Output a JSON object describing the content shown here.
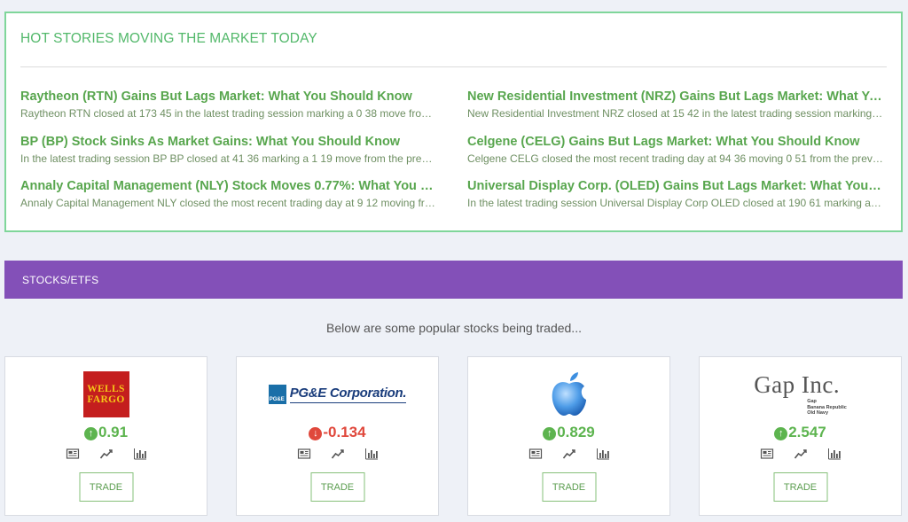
{
  "hot_stories": {
    "title": "HOT STORIES MOVING THE MARKET TODAY",
    "items": [
      {
        "title": "Raytheon (RTN) Gains But Lags Market: What You Should Know",
        "desc": "Raytheon RTN closed at 173 45 in the latest trading session marking a 0 38 move from the prior day"
      },
      {
        "title": "New Residential Investment (NRZ) Gains But Lags Market: What You Should Know",
        "desc": "New Residential Investment NRZ closed at 15 42 in the latest trading session marking a move from the prior day"
      },
      {
        "title": "BP (BP) Stock Sinks As Market Gains: What You Should Know",
        "desc": "In the latest trading session BP BP closed at 41 36 marking a 1 19 move from the previous day"
      },
      {
        "title": "Celgene (CELG) Gains But Lags Market: What You Should Know",
        "desc": "Celgene CELG closed the most recent trading day at 94 36 moving 0 51 from the previous trading session"
      },
      {
        "title": "Annaly Capital Management (NLY) Stock Moves 0.77%: What You Should Know",
        "desc": "Annaly Capital Management NLY closed the most recent trading day at 9 12 moving from the previous session"
      },
      {
        "title": "Universal Display Corp. (OLED) Gains But Lags Market: What You Should Know",
        "desc": "In the latest trading session Universal Display Corp OLED closed at 190 61 marking a move from the previous day"
      }
    ]
  },
  "section": {
    "title": "STOCKS/ETFS"
  },
  "intro": "Below are some popular stocks being traded...",
  "stocks": [
    {
      "logo_text": [
        "WELLS",
        "FARGO"
      ],
      "change": "0.91",
      "direction": "up",
      "trade_label": "TRADE"
    },
    {
      "logo_text": [
        "PG&E Corporation.",
        "PG&E"
      ],
      "change": "-0.134",
      "direction": "down",
      "trade_label": "TRADE"
    },
    {
      "logo_text": [],
      "change": "0.829",
      "direction": "up",
      "trade_label": "TRADE"
    },
    {
      "logo_text": [
        "Gap Inc.",
        "Gap",
        "Banana Republic",
        "Old Navy"
      ],
      "change": "2.547",
      "direction": "up",
      "trade_label": "TRADE"
    }
  ],
  "colors": {
    "accent_green": "#52b86a",
    "section_purple": "#8350b8",
    "up": "#5db44f",
    "down": "#e0483c"
  },
  "icons": [
    "arrow-up-circle-icon",
    "arrow-down-circle-icon",
    "news-icon",
    "line-chart-icon",
    "bar-chart-icon"
  ]
}
